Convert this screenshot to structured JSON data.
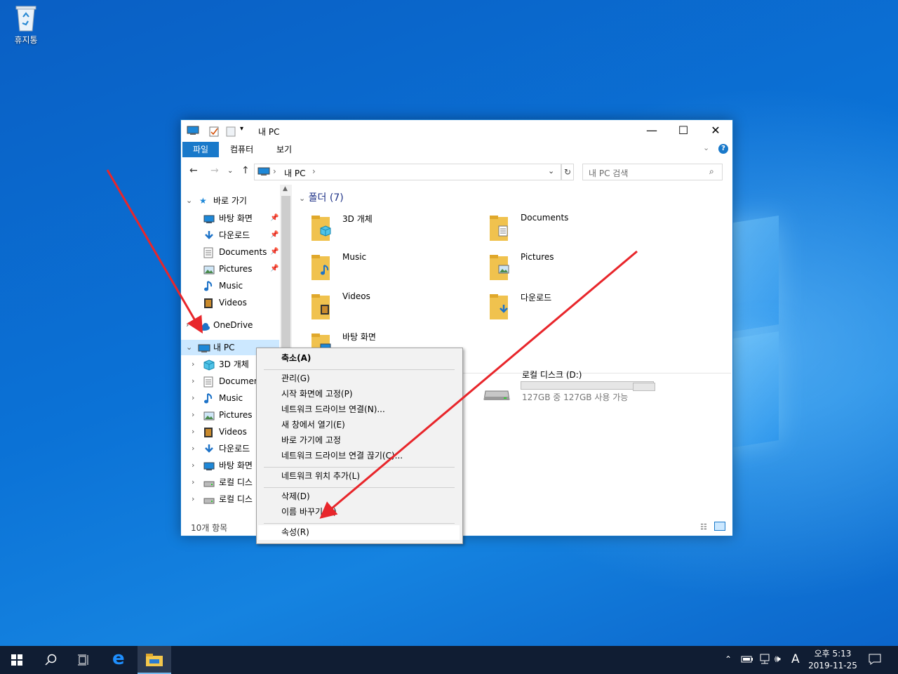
{
  "desktop": {
    "recycle_bin_label": "휴지통"
  },
  "window": {
    "title": "내 PC",
    "controls": {
      "minimize": "—",
      "maximize": "☐",
      "close": "✕"
    }
  },
  "ribbon": {
    "tabs": [
      "파일",
      "컴퓨터",
      "보기"
    ]
  },
  "address": {
    "path": "내 PC",
    "search_placeholder": "내 PC 검색"
  },
  "nav": {
    "quick_access": "바로 가기",
    "quick_items": [
      {
        "label": "바탕 화면",
        "icon": "desktop-icon"
      },
      {
        "label": "다운로드",
        "icon": "download-icon"
      },
      {
        "label": "Documents",
        "icon": "documents-icon"
      },
      {
        "label": "Pictures",
        "icon": "pictures-icon"
      },
      {
        "label": "Music",
        "icon": "music-icon"
      },
      {
        "label": "Videos",
        "icon": "videos-icon"
      }
    ],
    "onedrive": "OneDrive",
    "this_pc": "내 PC",
    "pc_items": [
      {
        "label": "3D 개체",
        "icon": "3d-objects-icon"
      },
      {
        "label": "Document",
        "icon": "documents-icon"
      },
      {
        "label": "Music",
        "icon": "music-icon"
      },
      {
        "label": "Pictures",
        "icon": "pictures-icon"
      },
      {
        "label": "Videos",
        "icon": "videos-icon"
      },
      {
        "label": "다운로드",
        "icon": "download-icon"
      },
      {
        "label": "바탕 화면",
        "icon": "desktop-icon"
      },
      {
        "label": "로컬 디스",
        "icon": "drive-icon"
      },
      {
        "label": "로컬 디스",
        "icon": "drive-icon"
      }
    ]
  },
  "content": {
    "folders_header": "폴더 (7)",
    "folders": [
      {
        "name": "3D 개체",
        "icon": "3d-objects-icon"
      },
      {
        "name": "Documents",
        "icon": "documents-icon"
      },
      {
        "name": "Music",
        "icon": "music-icon"
      },
      {
        "name": "Pictures",
        "icon": "pictures-icon"
      },
      {
        "name": "Videos",
        "icon": "videos-icon"
      },
      {
        "name": "다운로드",
        "icon": "download-icon"
      },
      {
        "name": "바탕 화면",
        "icon": "desktop-icon"
      }
    ],
    "drive": {
      "name": "로컬 디스크 (D:)",
      "space": "127GB 중 127GB 사용 가능",
      "used_fraction": 0.0
    }
  },
  "status": {
    "item_count": "10개 항목"
  },
  "context_menu": {
    "items": [
      {
        "label": "축소(A)",
        "bold": true
      },
      {
        "label": "관리(G)"
      },
      {
        "label": "시작 화면에 고정(P)"
      },
      {
        "label": "네트워크 드라이브 연결(N)..."
      },
      {
        "label": "새 창에서 열기(E)"
      },
      {
        "label": "바로 가기에 고정"
      },
      {
        "label": "네트워크 드라이브 연결 끊기(C)..."
      },
      {
        "label": "네트워크 위치 추가(L)"
      },
      {
        "label": "삭제(D)"
      },
      {
        "label": "이름 바꾸기(M)"
      },
      {
        "label": "속성(R)",
        "highlighted": true
      }
    ]
  },
  "taskbar": {
    "tray_ime": "A",
    "time": "오후 5:13",
    "date": "2019-11-25"
  },
  "colors": {
    "accent": "#1979ca",
    "arrow": "#e8262b"
  }
}
